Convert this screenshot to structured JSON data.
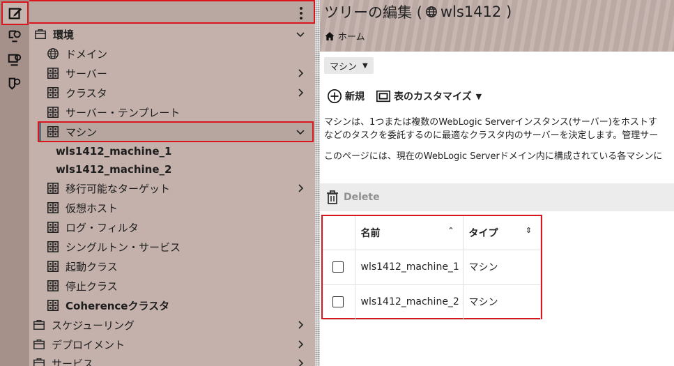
{
  "tree": {
    "items": [
      {
        "label": "環境",
        "icon": "briefcase-icon",
        "chevron": "down",
        "bold": true
      },
      {
        "label": "ドメイン",
        "icon": "globe-icon"
      },
      {
        "label": "サーバー",
        "icon": "grid-icon",
        "chevron": "right"
      },
      {
        "label": "クラスタ",
        "icon": "grid-icon",
        "chevron": "right"
      },
      {
        "label": "サーバー・テンプレート",
        "icon": "grid-icon"
      },
      {
        "label": "マシン",
        "icon": "grid-icon",
        "chevron": "down",
        "selected": true
      },
      {
        "label": "wls1412_machine_1"
      },
      {
        "label": "wls1412_machine_2"
      },
      {
        "label": "移行可能なターゲット",
        "icon": "grid-icon",
        "chevron": "right"
      },
      {
        "label": "仮想ホスト",
        "icon": "grid-icon"
      },
      {
        "label": "ログ・フィルタ",
        "icon": "grid-icon"
      },
      {
        "label": "シングルトン・サービス",
        "icon": "grid-icon"
      },
      {
        "label": "起動クラス",
        "icon": "grid-icon"
      },
      {
        "label": "停止クラス",
        "icon": "grid-icon"
      },
      {
        "label": "Coherenceクラスタ",
        "icon": "grid-icon"
      },
      {
        "label": "スケジューリング",
        "icon": "briefcase-icon",
        "chevron": "right"
      },
      {
        "label": "デプロイメント",
        "icon": "briefcase-icon",
        "chevron": "right"
      },
      {
        "label": "サービス",
        "icon": "briefcase-icon",
        "chevron": "right"
      }
    ]
  },
  "content": {
    "title_prefix": "ツリーの編集 (",
    "title_domain": "wls1412",
    "title_suffix": ")",
    "breadcrumb": "ホーム",
    "type_select": "マシン",
    "new_label": "新規",
    "customize_label": "表のカスタマイズ",
    "description1": "マシンは、1つまたは複数のWebLogic Serverインスタンス(サーバー)をホストす",
    "description2": "などのタスクを委託するのに最適なクラスタ内のサーバーを決定します。管理サー",
    "description3": "このページには、現在のWebLogic Serverドメイン内に構成されている各マシンに",
    "delete_label": "Delete"
  },
  "table": {
    "headers": [
      "名前",
      "タイプ"
    ],
    "rows": [
      [
        "wls1412_machine_1",
        "マシン"
      ],
      [
        "wls1412_machine_2",
        "マシン"
      ]
    ]
  },
  "colors": {
    "highlight_border": "#d9161d",
    "tree_bg": "#c4b1ac"
  }
}
